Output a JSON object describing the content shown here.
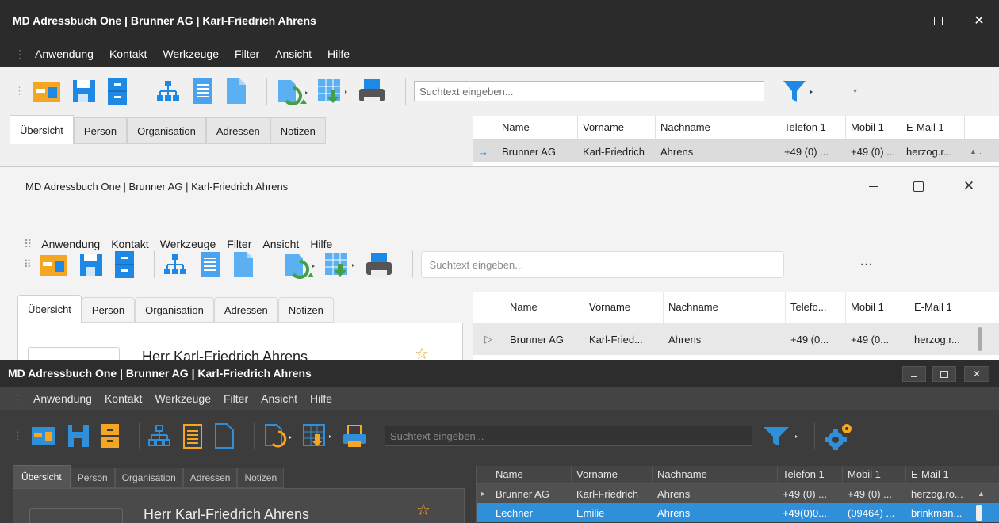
{
  "colors": {
    "dark_title": "#2b2b2b",
    "win10_bg": "#f0f0f0",
    "win11_bg": "#f3f3f3",
    "dark_theme_bg": "#3c3c3c",
    "accent_blue": "#1e88e5",
    "accent_orange": "#f5a623",
    "accent_green": "#43a047",
    "dark_accent": "#2f8fd8"
  },
  "windows": [
    {
      "title": "MD Adressbuch One | Brunner AG | Karl-Friedrich Ahrens",
      "menu": [
        "Anwendung",
        "Kontakt",
        "Werkzeuge",
        "Filter",
        "Ansicht",
        "Hilfe"
      ],
      "search_placeholder": "Suchtext eingeben...",
      "tabs": [
        "Übersicht",
        "Person",
        "Organisation",
        "Adressen",
        "Notizen"
      ],
      "columns": [
        "Name",
        "Vorname",
        "Nachname",
        "Telefon 1",
        "Mobil 1",
        "E-Mail 1"
      ],
      "rows": [
        {
          "marker": "→",
          "cells": [
            "Brunner AG",
            "Karl-Friedrich",
            "Ahrens",
            "+49 (0) ...",
            "+49 (0) ...",
            "herzog.r..."
          ]
        }
      ]
    },
    {
      "title": "MD Adressbuch One | Brunner AG | Karl-Friedrich Ahrens",
      "menu": [
        "Anwendung",
        "Kontakt",
        "Werkzeuge",
        "Filter",
        "Ansicht",
        "Hilfe"
      ],
      "search_placeholder": "Suchtext eingeben...",
      "more_label": "···",
      "tabs": [
        "Übersicht",
        "Person",
        "Organisation",
        "Adressen",
        "Notizen"
      ],
      "columns": [
        "Name",
        "Vorname",
        "Nachname",
        "Telefo...",
        "Mobil 1",
        "E-Mail 1"
      ],
      "rows": [
        {
          "marker": "▷",
          "cells": [
            "Brunner AG",
            "Karl-Fried...",
            "Ahrens",
            "+49 (0...",
            "+49 (0...",
            "herzog.r..."
          ]
        }
      ],
      "contact_name": "Herr Karl-Friedrich Ahrens"
    },
    {
      "title": "MD Adressbuch One | Brunner AG | Karl-Friedrich Ahrens",
      "menu": [
        "Anwendung",
        "Kontakt",
        "Werkzeuge",
        "Filter",
        "Ansicht",
        "Hilfe"
      ],
      "search_placeholder": "Suchtext eingeben...",
      "tabs": [
        "Übersicht",
        "Person",
        "Organisation",
        "Adressen",
        "Notizen"
      ],
      "columns": [
        "Name",
        "Vorname",
        "Nachname",
        "Telefon 1",
        "Mobil 1",
        "E-Mail 1"
      ],
      "rows": [
        {
          "marker": "▸",
          "cells": [
            "Brunner AG",
            "Karl-Friedrich",
            "Ahrens",
            "+49 (0) ...",
            "+49 (0) ...",
            "herzog.ro..."
          ]
        },
        {
          "marker": "",
          "cells": [
            "Lechner",
            "Emilie",
            "Ahrens",
            "+49(0)0...",
            "(09464) ...",
            "brinkman..."
          ]
        }
      ],
      "contact_name": "Herr Karl-Friedrich Ahrens"
    }
  ]
}
